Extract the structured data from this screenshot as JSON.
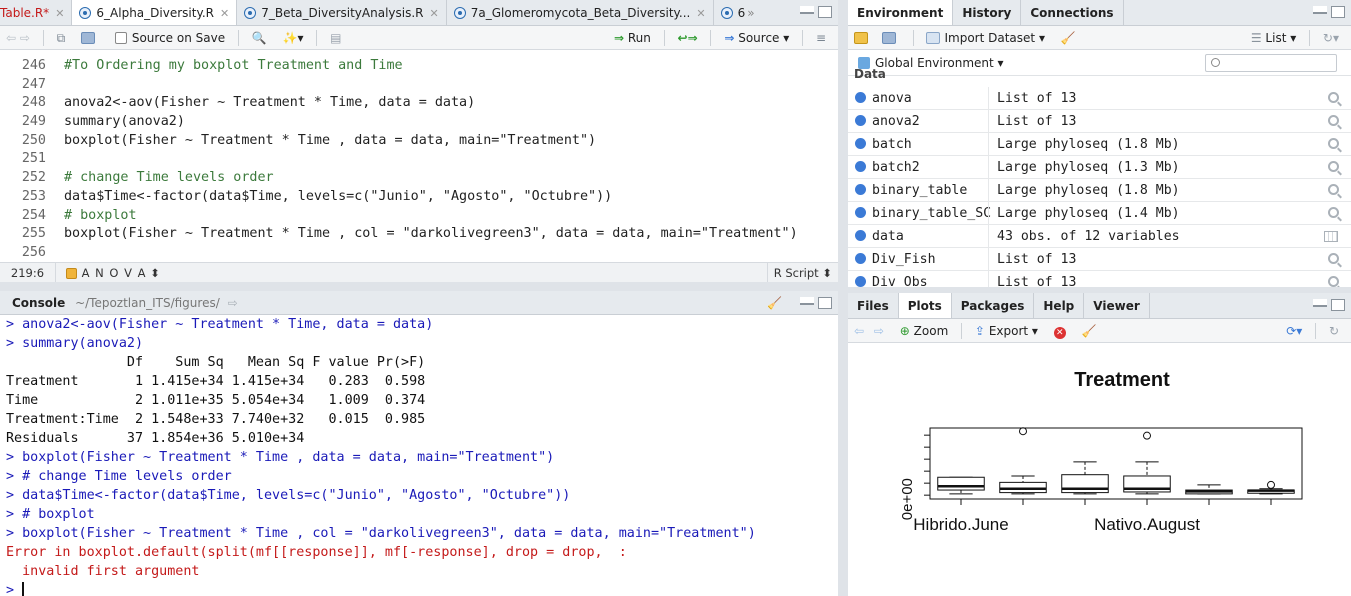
{
  "editor": {
    "tabs": [
      {
        "label": "Table.R*",
        "modified": true
      },
      {
        "label": "6_Alpha_Diversity.R"
      },
      {
        "label": "7_Beta_DiversityAnalysis.R"
      },
      {
        "label": "7a_Glomeromycota_Beta_Diversity..."
      },
      {
        "label": "6"
      }
    ],
    "toolbar": {
      "source_on_save": "Source on Save",
      "run": "Run",
      "source": "Source"
    },
    "lines": [
      {
        "n": "246",
        "t": "#To Ordering my boxplot Treatment and Time"
      },
      {
        "n": "247",
        "t": ""
      },
      {
        "n": "248",
        "t": "anova2<-aov(Fisher ~ Treatment * Time, data = data)"
      },
      {
        "n": "249",
        "t": "summary(anova2)"
      },
      {
        "n": "250",
        "t": "boxplot(Fisher ~ Treatment * Time , data = data, main=\"Treatment\")"
      },
      {
        "n": "251",
        "t": ""
      },
      {
        "n": "252",
        "t": "# change Time levels order"
      },
      {
        "n": "253",
        "t": "data$Time<-factor(data$Time, levels=c(\"Junio\", \"Agosto\", \"Octubre\"))"
      },
      {
        "n": "254",
        "t": "# boxplot"
      },
      {
        "n": "255",
        "t": "boxplot(Fisher ~ Treatment * Time , col = \"darkolivegreen3\", data = data, main=\"Treatment\")"
      },
      {
        "n": "256",
        "t": ""
      }
    ],
    "status": {
      "position": "219:6",
      "section": "A N O V A",
      "filetype": "R Script"
    }
  },
  "console": {
    "title": "Console",
    "path": "~/Tepoztlan_ITS/figures/",
    "lines": [
      {
        "k": "in",
        "t": "> anova2<-aov(Fisher ~ Treatment * Time, data = data)"
      },
      {
        "k": "in",
        "t": "> summary(anova2)"
      },
      {
        "k": "out",
        "t": "               Df    Sum Sq   Mean Sq F value Pr(>F)"
      },
      {
        "k": "out",
        "t": "Treatment       1 1.415e+34 1.415e+34   0.283  0.598"
      },
      {
        "k": "out",
        "t": "Time            2 1.011e+35 5.054e+34   1.009  0.374"
      },
      {
        "k": "out",
        "t": "Treatment:Time  2 1.548e+33 7.740e+32   0.015  0.985"
      },
      {
        "k": "out",
        "t": "Residuals      37 1.854e+36 5.010e+34"
      },
      {
        "k": "in",
        "t": "> boxplot(Fisher ~ Treatment * Time , data = data, main=\"Treatment\")"
      },
      {
        "k": "in",
        "t": "> # change Time levels order"
      },
      {
        "k": "in",
        "t": "> data$Time<-factor(data$Time, levels=c(\"Junio\", \"Agosto\", \"Octubre\"))"
      },
      {
        "k": "in",
        "t": "> # boxplot"
      },
      {
        "k": "in",
        "t": "> boxplot(Fisher ~ Treatment * Time , col = \"darkolivegreen3\", data = data, main=\"Treatment\")"
      },
      {
        "k": "err",
        "t": "Error in boxplot.default(split(mf[[response]], mf[-response], drop = drop,  :"
      },
      {
        "k": "err",
        "t": "  invalid first argument"
      },
      {
        "k": "in",
        "t": "> "
      }
    ]
  },
  "environment": {
    "tabs": [
      "Environment",
      "History",
      "Connections"
    ],
    "import_dataset": "Import Dataset",
    "list_view": "List",
    "scope": "Global Environment",
    "section": "Data",
    "rows": [
      {
        "name": "anova",
        "value": "List of 13",
        "icon": "magnifier"
      },
      {
        "name": "anova2",
        "value": "List of 13",
        "icon": "magnifier"
      },
      {
        "name": "batch",
        "value": "Large phyloseq (1.8 Mb)",
        "icon": "magnifier"
      },
      {
        "name": "batch2",
        "value": "Large phyloseq (1.3 Mb)",
        "icon": "magnifier"
      },
      {
        "name": "binary_table",
        "value": "Large phyloseq (1.8 Mb)",
        "icon": "magnifier"
      },
      {
        "name": "binary_table_SC",
        "value": "Large phyloseq (1.4 Mb)",
        "icon": "magnifier"
      },
      {
        "name": "data",
        "value": "43 obs. of 12 variables",
        "icon": "grid"
      },
      {
        "name": "Div_Fish",
        "value": "List of 13",
        "icon": "magnifier"
      },
      {
        "name": "Div_Obs",
        "value": "List of 13",
        "icon": "magnifier"
      }
    ]
  },
  "files": {
    "tabs": [
      "Files",
      "Plots",
      "Packages",
      "Help",
      "Viewer"
    ],
    "active_tab": "Plots",
    "zoom": "Zoom",
    "export": "Export"
  },
  "chart_data": {
    "type": "box",
    "title": "Treatment",
    "xlabel": "",
    "ylabel": "",
    "y_tick_label": "0e+00",
    "x_tick_labels": [
      "Hibrido.June",
      "Nativo.August"
    ],
    "groups": 6,
    "boxes": [
      {
        "min": 0.02,
        "q1": 0.08,
        "median": 0.14,
        "q3": 0.28,
        "max": 0.28,
        "outliers": []
      },
      {
        "min": 0.02,
        "q1": 0.04,
        "median": 0.1,
        "q3": 0.2,
        "max": 0.3,
        "outliers": [
          1.0
        ]
      },
      {
        "min": 0.02,
        "q1": 0.04,
        "median": 0.1,
        "q3": 0.32,
        "max": 0.52,
        "outliers": []
      },
      {
        "min": 0.02,
        "q1": 0.05,
        "median": 0.1,
        "q3": 0.3,
        "max": 0.52,
        "outliers": [
          0.93
        ]
      },
      {
        "min": 0.02,
        "q1": 0.02,
        "median": 0.06,
        "q3": 0.08,
        "max": 0.16,
        "outliers": []
      },
      {
        "min": 0.02,
        "q1": 0.03,
        "median": 0.07,
        "q3": 0.08,
        "max": 0.1,
        "outliers": [
          0.16
        ]
      }
    ],
    "ylim": [
      -0.06,
      1.05
    ]
  }
}
